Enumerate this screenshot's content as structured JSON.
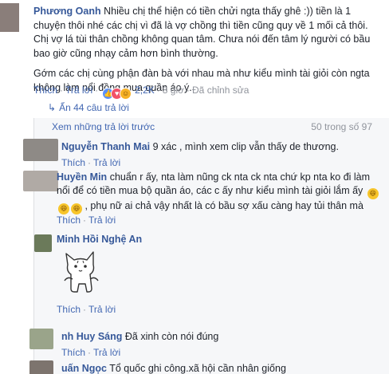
{
  "main_comment": {
    "author": "Phương Oanh",
    "text_para1": "Nhiều chị thể hiện có tiền chửi ngta thấy ghê :)) tiền là 1 chuyện thôi nhé các chị vì đã là vợ chồng thì tiền cũng quy về 1 mối cả thôi. Chị vợ lá tùi thân chồng không quan tâm. Chưa nói đến tâm lý người có bầu bao giờ cũng nhạy cảm hơn bình thường.",
    "text_para2": "Gớm các chị cùng phận đàn bà với nhau mà như kiểu mình tài giỏi còn ngta không làm nổi đồng mua quần áo ý.",
    "like_label": "Thích",
    "reply_label": "Trả lời",
    "reaction_count": "2,2K",
    "time": "8 giờ",
    "edited_label": "Đã chỉnh sửa"
  },
  "replies_toggle": {
    "label": "Ẩn 44 câu trả lời"
  },
  "replies": {
    "previous_label": "Xem những trả lời trước",
    "count_label": "50 trong số 97",
    "items": [
      {
        "author": "Nguyễn Thanh Mai",
        "text": "9 xác , mình xem clip vẫn thấy de thương.",
        "like_label": "Thích",
        "reply_label": "Trả lời"
      },
      {
        "author": "Huyền Min",
        "text_line1": "chuẩn r ấy, nta làm nũng ck nta ck nta chứ kp nta ko đi làm nổi để có tiền mua bộ quần áo, các c ấy như kiểu mình tài giỏi lắm ấy",
        "text_line2": ", phụ nữ ai chả vậy nhất là có bầu sợ xấu càng hay tủi thân mà",
        "like_label": "Thích",
        "reply_label": "Trả lời"
      },
      {
        "author": "Minh Hồi Nghệ An",
        "like_label": "Thích",
        "reply_label": "Trả lời"
      },
      {
        "author": "nh Huy Sáng",
        "text": "Đã xinh còn nói đúng",
        "like_label": "Thích",
        "reply_label": "Trả lời"
      },
      {
        "author": "uấn Ngọc",
        "text": "Tổ quốc ghi công.xã hội cần nhân giống"
      }
    ]
  },
  "colors": {
    "link": "#4267b2",
    "name": "#365899",
    "muted": "#90949c",
    "reply_bg": "#f6f7f9"
  }
}
